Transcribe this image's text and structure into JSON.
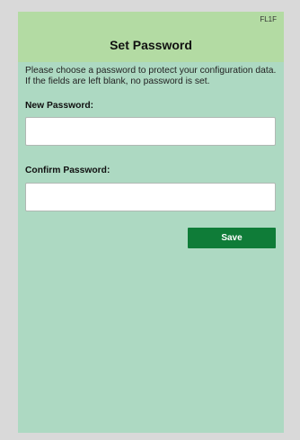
{
  "header": {
    "device_code": "FL1F",
    "title": "Set Password"
  },
  "intro": {
    "text": "Please choose a password to protect your configuration data. If the fields are left blank, no password is set."
  },
  "form": {
    "new_password_label": "New Password:",
    "new_password_value": "",
    "confirm_password_label": "Confirm Password:",
    "confirm_password_value": "",
    "save_label": "Save"
  },
  "colors": {
    "page_background": "#d9d9d9",
    "screen_background": "#add9c2",
    "header_background": "#b3dba3",
    "save_button": "#0f7c38"
  }
}
